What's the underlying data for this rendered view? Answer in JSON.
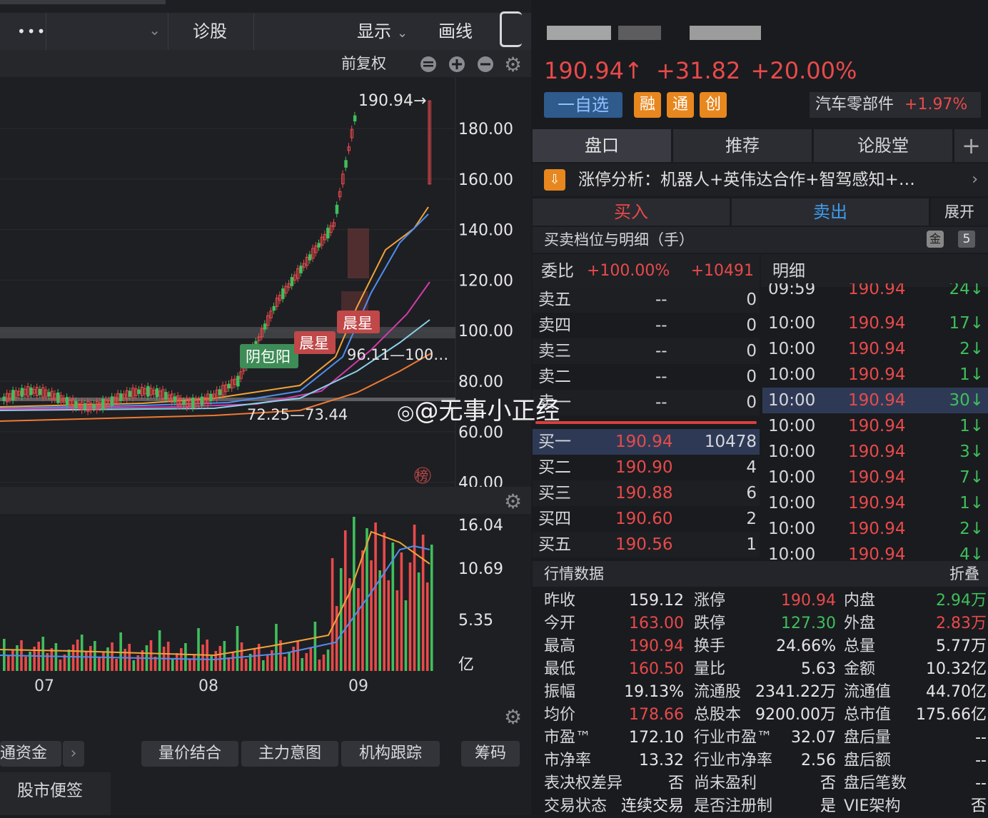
{
  "toolbar": {
    "more": "•••",
    "diagnose": "诊股",
    "display": "显示",
    "draw": "画线"
  },
  "chart_header": {
    "adjust": "前复权"
  },
  "chart_data": {
    "type": "candlestick",
    "price_axis": [
      "180.00",
      "160.00",
      "140.00",
      "120.00",
      "100.00",
      "80.00",
      "60.00",
      "40.00"
    ],
    "high_label": "190.94→",
    "zone_labels": [
      "96.11—100…",
      "72.25—73.44"
    ],
    "patterns": [
      "阴包阳",
      "晨星",
      "晨星"
    ],
    "volume_axis": [
      "16.04",
      "10.69",
      "5.35",
      "亿"
    ],
    "months": [
      "07",
      "08",
      "09"
    ],
    "ranking_icon": "榜"
  },
  "bottom_tabs": {
    "capital": "通资金",
    "vol_price": "量价结合",
    "main_intent": "主力意图",
    "inst_track": "机构跟踪",
    "chips": "筹码"
  },
  "notes": "股市便签",
  "quote": {
    "price": "190.94↑",
    "change": "+31.82",
    "pct": "+20.00%"
  },
  "tags": {
    "watch": "一自选",
    "rong": "融",
    "tong": "通",
    "chuang": "创",
    "sector": "汽车零部件",
    "sector_pct": "+1.97%"
  },
  "tabs": {
    "book": "盘口",
    "recommend": "推荐",
    "forum": "论股堂",
    "add": "+"
  },
  "limit_analysis": "涨停分析：机器人+英伟达合作+智驾感知+…",
  "trade": {
    "buy": "买入",
    "sell": "卖出",
    "expand": "展开"
  },
  "book_title": "买卖档位与明细（手）",
  "book_badge": "5",
  "weibi": {
    "label": "委比",
    "pct": "+100.00%",
    "diff": "+10491"
  },
  "detail_title": "明细",
  "asks": [
    {
      "label": "卖五",
      "price": "--",
      "vol": "0"
    },
    {
      "label": "卖四",
      "price": "--",
      "vol": "0"
    },
    {
      "label": "卖三",
      "price": "--",
      "vol": "0"
    },
    {
      "label": "卖二",
      "price": "--",
      "vol": "0"
    },
    {
      "label": "卖一",
      "price": "--",
      "vol": "0"
    }
  ],
  "bids": [
    {
      "label": "买一",
      "price": "190.94",
      "vol": "10478"
    },
    {
      "label": "买二",
      "price": "190.90",
      "vol": "4"
    },
    {
      "label": "买三",
      "price": "190.88",
      "vol": "6"
    },
    {
      "label": "买四",
      "price": "190.60",
      "vol": "2"
    },
    {
      "label": "买五",
      "price": "190.56",
      "vol": "1"
    }
  ],
  "ticks": [
    {
      "time": "09:59",
      "price": "190.94",
      "vol": "24↓"
    },
    {
      "time": "10:00",
      "price": "190.94",
      "vol": "17↓"
    },
    {
      "time": "10:00",
      "price": "190.94",
      "vol": "2↓"
    },
    {
      "time": "10:00",
      "price": "190.94",
      "vol": "1↓"
    },
    {
      "time": "10:00",
      "price": "190.94",
      "vol": "30↓"
    },
    {
      "time": "10:00",
      "price": "190.94",
      "vol": "1↓"
    },
    {
      "time": "10:00",
      "price": "190.94",
      "vol": "3↓"
    },
    {
      "time": "10:00",
      "price": "190.94",
      "vol": "7↓"
    },
    {
      "time": "10:00",
      "price": "190.94",
      "vol": "1↓"
    },
    {
      "time": "10:00",
      "price": "190.94",
      "vol": "2↓"
    },
    {
      "time": "10:00",
      "price": "190.94",
      "vol": "4↓"
    }
  ],
  "watermark": "@无事小正经",
  "market": {
    "title": "行情数据",
    "fold": "折叠"
  },
  "stats": [
    [
      {
        "k": "昨收",
        "v": "159.12",
        "c": "white"
      },
      {
        "k": "涨停",
        "v": "190.94",
        "c": "up"
      },
      {
        "k": "内盘",
        "v": "2.94万",
        "c": "down"
      }
    ],
    [
      {
        "k": "今开",
        "v": "163.00",
        "c": "up"
      },
      {
        "k": "跌停",
        "v": "127.30",
        "c": "down"
      },
      {
        "k": "外盘",
        "v": "2.83万",
        "c": "up"
      }
    ],
    [
      {
        "k": "最高",
        "v": "190.94",
        "c": "up"
      },
      {
        "k": "换手",
        "v": "24.66%",
        "c": "white"
      },
      {
        "k": "总量",
        "v": "5.77万",
        "c": "white"
      }
    ],
    [
      {
        "k": "最低",
        "v": "160.50",
        "c": "up"
      },
      {
        "k": "量比",
        "v": "5.63",
        "c": "white"
      },
      {
        "k": "金额",
        "v": "10.32亿",
        "c": "white"
      }
    ],
    [
      {
        "k": "振幅",
        "v": "19.13%",
        "c": "white"
      },
      {
        "k": "流通股",
        "v": "2341.22万",
        "c": "white"
      },
      {
        "k": "流通值",
        "v": "44.70亿",
        "c": "white"
      }
    ],
    [
      {
        "k": "均价",
        "v": "178.66",
        "c": "up"
      },
      {
        "k": "总股本",
        "v": "9200.00万",
        "c": "white"
      },
      {
        "k": "总市值",
        "v": "175.66亿",
        "c": "white"
      }
    ],
    [
      {
        "k": "市盈™",
        "v": "172.10",
        "c": "white"
      },
      {
        "k": "行业市盈™",
        "v": "32.07",
        "c": "white"
      },
      {
        "k": "盘后量",
        "v": "--",
        "c": "white"
      }
    ],
    [
      {
        "k": "市净率",
        "v": "13.32",
        "c": "white"
      },
      {
        "k": "行业市净率",
        "v": "2.56",
        "c": "white"
      },
      {
        "k": "盘后额",
        "v": "--",
        "c": "white"
      }
    ],
    [
      {
        "k": "表决权差异",
        "v": "否",
        "c": "white"
      },
      {
        "k": "尚未盈利",
        "v": "否",
        "c": "white"
      },
      {
        "k": "盘后笔数",
        "v": "--",
        "c": "white"
      }
    ],
    [
      {
        "k": "交易状态",
        "v": "连续交易",
        "c": "white"
      },
      {
        "k": "是否注册制",
        "v": "是",
        "c": "white"
      },
      {
        "k": "VIE架构",
        "v": "否",
        "c": "white"
      }
    ]
  ]
}
